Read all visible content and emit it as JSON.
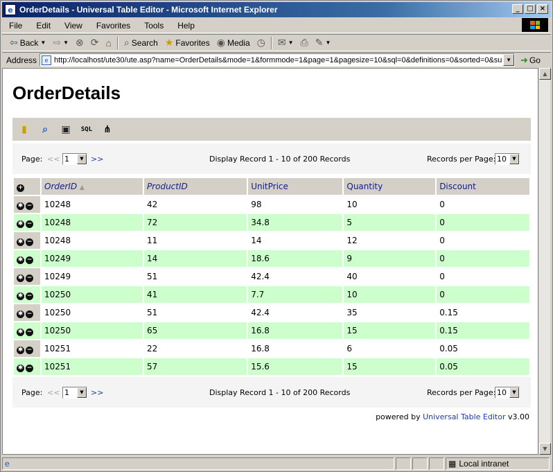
{
  "window": {
    "title": "OrderDetails - Universal Table Editor - Microsoft Internet Explorer"
  },
  "menu": [
    "File",
    "Edit",
    "View",
    "Favorites",
    "Tools",
    "Help"
  ],
  "toolbar": {
    "back": "Back",
    "search": "Search",
    "favorites": "Favorites",
    "media": "Media"
  },
  "address": {
    "label": "Address",
    "url": "http://localhost/ute30/ute.asp?name=OrderDetails&mode=1&formmode=1&page=1&pagesize=10&sql=0&definitions=0&sorted=0&su",
    "go": "Go"
  },
  "page": {
    "heading": "OrderDetails"
  },
  "pager": {
    "page_label": "Page:",
    "prev": "<<",
    "page": "1",
    "next": ">>",
    "display": "Display Record 1 - 10 of 200 Records",
    "rpp_label": "Records per Page:",
    "rpp": "10"
  },
  "table": {
    "columns": [
      "OrderID",
      "ProductID",
      "UnitPrice",
      "Quantity",
      "Discount"
    ],
    "rows": [
      [
        "10248",
        "42",
        "98",
        "10",
        "0"
      ],
      [
        "10248",
        "72",
        "34.8",
        "5",
        "0"
      ],
      [
        "10248",
        "11",
        "14",
        "12",
        "0"
      ],
      [
        "10249",
        "14",
        "18.6",
        "9",
        "0"
      ],
      [
        "10249",
        "51",
        "42.4",
        "40",
        "0"
      ],
      [
        "10250",
        "41",
        "7.7",
        "10",
        "0"
      ],
      [
        "10250",
        "51",
        "42.4",
        "35",
        "0.15"
      ],
      [
        "10250",
        "65",
        "16.8",
        "15",
        "0.15"
      ],
      [
        "10251",
        "22",
        "16.8",
        "6",
        "0.05"
      ],
      [
        "10251",
        "57",
        "15.6",
        "15",
        "0.05"
      ]
    ]
  },
  "footer": {
    "powered": "powered by",
    "link": "Universal Table Editor",
    "version": "v3.00"
  },
  "status": {
    "zone": "Local intranet"
  }
}
